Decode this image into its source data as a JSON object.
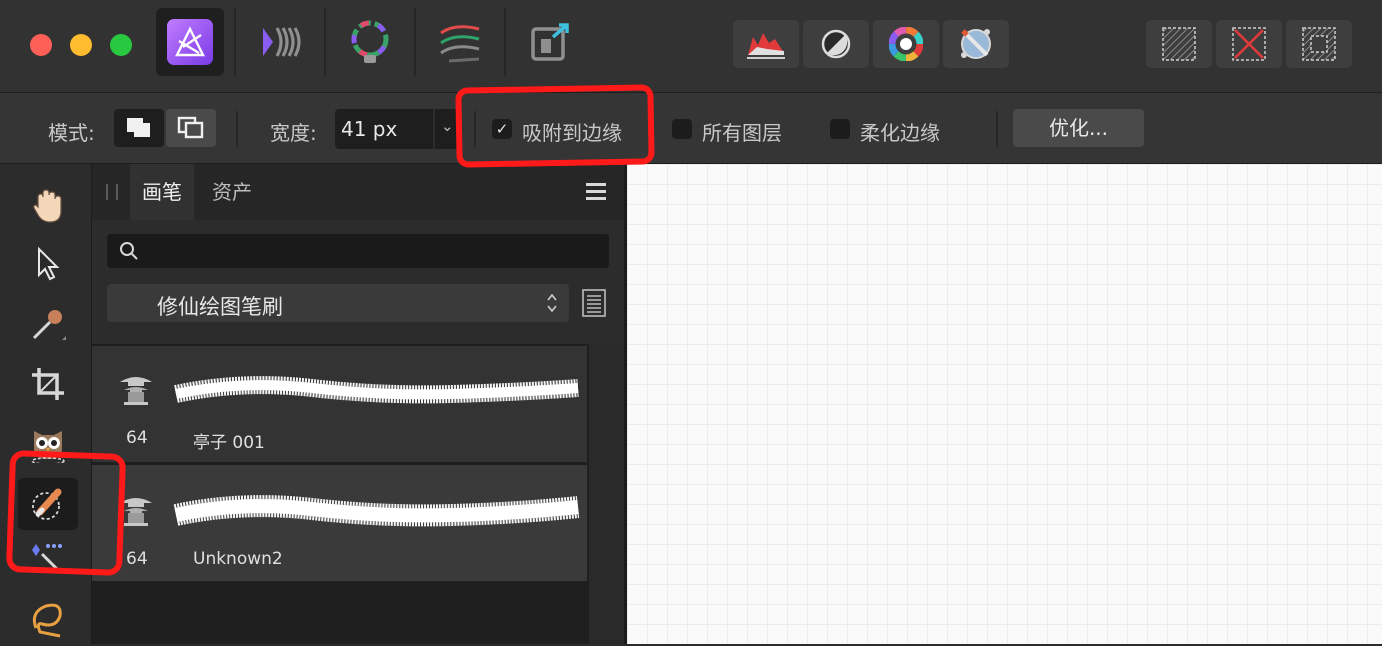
{
  "context_toolbar": {
    "mode_label": "模式:",
    "width_label": "宽度:",
    "width_value": "41 px",
    "snap_to_edges": {
      "label": "吸附到边缘",
      "checked": true,
      "check_glyph": "✓"
    },
    "all_layers": {
      "label": "所有图层",
      "checked": false
    },
    "soften_edges": {
      "label": "柔化边缘",
      "checked": false
    },
    "refine_button": "优化..."
  },
  "brushes_panel": {
    "tabs": [
      {
        "label": "画笔",
        "active": true
      },
      {
        "label": "资产",
        "active": false
      }
    ],
    "search_placeholder": "",
    "category": "修仙绘图笔刷",
    "brushes": [
      {
        "size": "64",
        "name": "亭子 001"
      },
      {
        "size": "64",
        "name": "Unknown2"
      }
    ]
  },
  "icons": {
    "personas": [
      "photo-persona-icon",
      "liquify-persona-icon",
      "develop-persona-icon",
      "tone-mapping-persona-icon",
      "export-persona-icon"
    ],
    "center_tools": [
      "histogram-icon",
      "adjustments-icon",
      "color-wheel-icon",
      "brush-studio-icon"
    ],
    "selection_tools": [
      "select-all-icon",
      "deselect-icon",
      "invert-selection-icon"
    ],
    "tools": [
      "view-hand-icon",
      "move-arrow-icon",
      "color-picker-icon",
      "crop-icon",
      "selection-brush-owl-icon",
      "selection-brush-icon",
      "flood-select-icon",
      "freehand-selection-icon"
    ]
  },
  "colors": {
    "accent_red": "#ff1a1a",
    "traffic_close": "#fe5f57",
    "traffic_minimize": "#febc2e",
    "traffic_zoom": "#28c840",
    "photo_persona": "#a15cf0"
  }
}
